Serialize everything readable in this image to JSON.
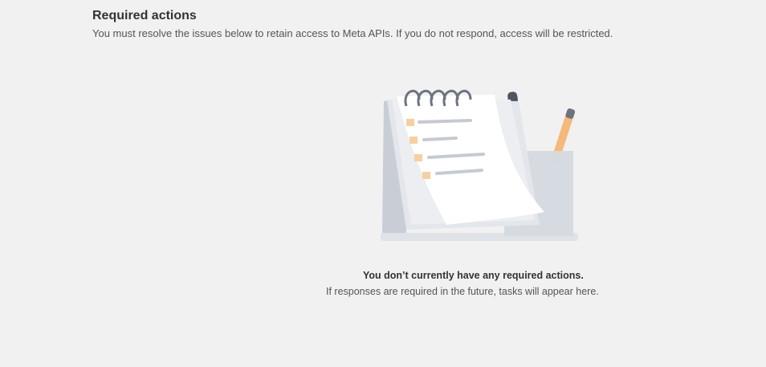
{
  "header": {
    "title": "Required actions",
    "subtitle": "You must resolve the issues below to retain access to Meta APIs. If you do not respond, access will be restricted."
  },
  "empty_state": {
    "illustration": "notepad-and-pens-illustration",
    "title": "You don’t currently have any required actions.",
    "body": "If responses are required in the future, tasks will appear here."
  },
  "colors": {
    "background": "#f1f1f1",
    "title_text": "#333333",
    "body_text": "#555555",
    "checkbox_accent": "#f8cfa0",
    "pen_dark": "#6b7480",
    "pencil_orange": "#f5b97a"
  }
}
